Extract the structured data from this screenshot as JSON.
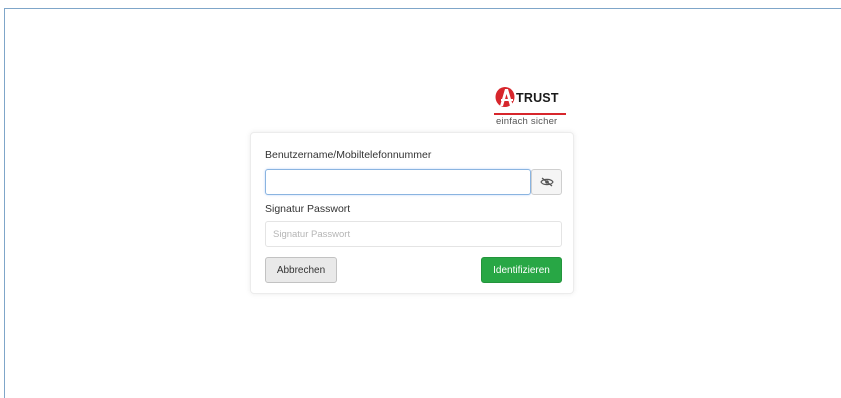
{
  "logo": {
    "brand": "TRUST",
    "tagline": "einfach sicher",
    "accent_color": "#d7262c"
  },
  "login": {
    "username_label": "Benutzername/Mobiltelefonnummer",
    "username_value": "",
    "toggle_icon": "eye-slash-icon",
    "password_label": "Signatur Passwort",
    "password_placeholder": "Signatur Passwort",
    "cancel_label": "Abbrechen",
    "identify_label": "Identifizieren",
    "identify_color": "#28a745"
  }
}
